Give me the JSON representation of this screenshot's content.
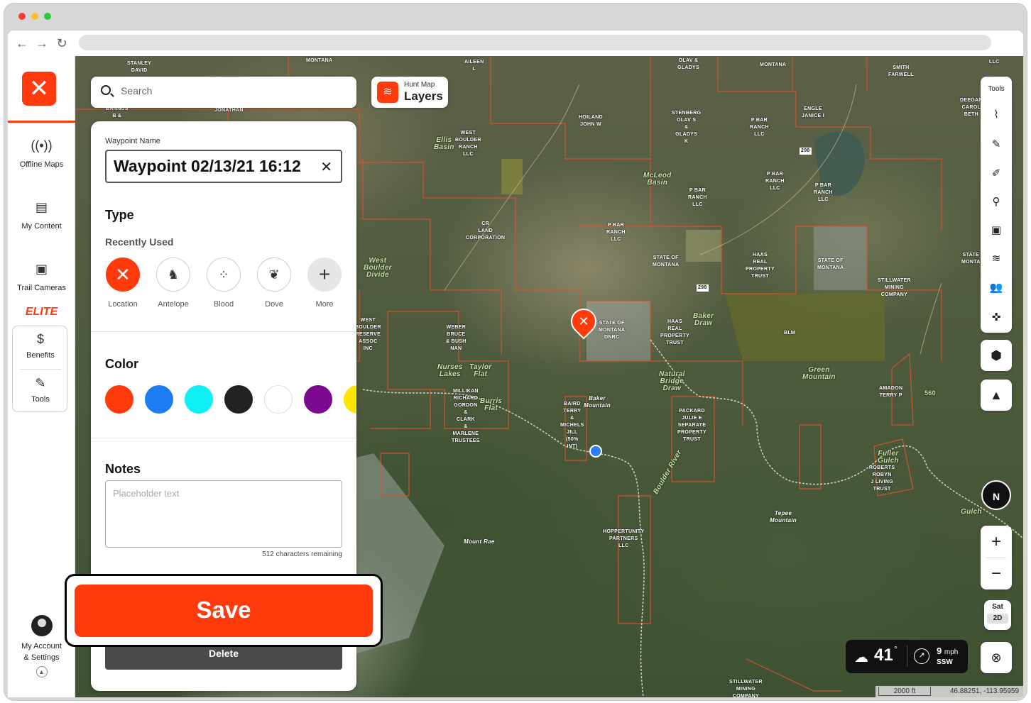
{
  "browser": {
    "traffic_colors": [
      "#ff3b30",
      "#ffbd2e",
      "#28c940"
    ],
    "nav_icons": [
      "back-arrow-icon",
      "forward-arrow-icon",
      "reload-icon"
    ]
  },
  "leftnav": {
    "logo_icon": "onx-x-icon",
    "items": [
      {
        "label": "Offline Maps",
        "icon": "broadcast-icon"
      },
      {
        "label": "My Content",
        "icon": "folder-icon"
      },
      {
        "label": "Trail Cameras",
        "icon": "camera-icon"
      }
    ],
    "elite": "ELITE",
    "benefits_label": "Benefits",
    "tools_label": "Tools",
    "account_line1": "My Account",
    "account_line2": "& Settings"
  },
  "search": {
    "placeholder": "Search"
  },
  "layers": {
    "small": "Hunt Map",
    "big": "Layers"
  },
  "panel": {
    "waypoint_label": "Waypoint Name",
    "waypoint_value": "Waypoint 02/13/21 16:12",
    "type_heading": "Type",
    "recently_used": "Recently Used",
    "types": [
      {
        "label": "Location",
        "glyph": "✕",
        "icon": "location-x-icon"
      },
      {
        "label": "Antelope",
        "glyph": "♞",
        "icon": "antelope-icon"
      },
      {
        "label": "Blood",
        "glyph": "⁘",
        "icon": "blood-drops-icon"
      },
      {
        "label": "Dove",
        "glyph": "❦",
        "icon": "dove-icon"
      },
      {
        "label": "More",
        "glyph": "+",
        "icon": "plus-icon"
      }
    ],
    "color_heading": "Color",
    "colors": [
      "#ff3a0d",
      "#1e7cf2",
      "#0ff0f5",
      "#222222",
      "#ffffff",
      "#7b0a8f",
      "#ffe600"
    ],
    "notes_heading": "Notes",
    "notes_placeholder": "Placeholder text",
    "chars_remaining": "512 characters remaining",
    "save": "Save",
    "delete": "Delete"
  },
  "tools": {
    "label": "Tools",
    "icons": [
      "lasso-icon",
      "pencil-icon",
      "eraser-icon",
      "map-pin-icon",
      "trail-camera-icon",
      "wind-icon",
      "people-icon",
      "satellite-icon"
    ]
  },
  "map_controls": {
    "hunt-icon": "hunt-area-icon",
    "terrain-icon": "terrain-icon",
    "compass": "N",
    "sat": "Sat",
    "mode": "2D"
  },
  "weather": {
    "temp": "41",
    "deg": "°",
    "wind_speed": "9",
    "wind_unit": "mph",
    "wind_dir": "SSW"
  },
  "status": {
    "scale": "2000 ft",
    "coords": "46.88251, -113.95959"
  },
  "map_labels": [
    "STANLEY\nDAVID",
    "MONTANA",
    "AILEEN\nL",
    "OLAV &\nGLADYS",
    "MONTANA",
    "SMITH\nFARWELL",
    "LLC",
    "DEEGAN\nCAROL\nBETH",
    "BANNUS\nB &",
    "JONATHAN",
    "HOILAND\nJOHN W",
    "STENBERG\nOLAV S\n&\nGLADYS\nK",
    "P BAR\nRANCH\nLLC",
    "ENGLE\nJANICE I",
    "WEST\nBOULDER\nRANCH\nLLC",
    "P BAR\nRANCH\nLLC",
    "P BAR\nRANCH\nLLC",
    "P BAR\nRANCH\nLLC",
    "CR\nLAND\nCORPORATION",
    "P BAR\nRANCH\nLLC",
    "STATE OF\nMONTANA",
    "HAAS\nREAL\nPROPERTY\nTRUST",
    "STATE OF\nMONTANA",
    "STATE\nMONTA",
    "STILLWATER\nMINING\nCOMPANY",
    "WEST\nBOULDER\nRESERVE\nASSOC\nINC",
    "WEBER\nBRUCE\n& BUSH\nNAN",
    "STATE OF\nMONTANA\nDNRC",
    "HAAS\nREAL\nPROPERTY\nTRUST",
    "BLM",
    "AMADON\nTERRY P",
    "MILLIKAN\nRICHARD\nGORDON\n&\nCLARK\n&\nMARLENE\nTRUSTEES",
    "BAIRD\nTERRY\n&\nMICHELS\nJILL\n(50%\nINT)",
    "PACKARD\nJULIE E\nSEPARATE\nPROPERTY\nTRUST",
    "ROBERTS\nROBYN\nJ LIVING\nTRUST",
    "HOPPERTUNITY\nPARTNERS\nLLC",
    "STILLWATER\nMINING\nCOMPANY",
    "298",
    "298",
    "560"
  ],
  "geo_labels": [
    "Ellis\nBasin",
    "McLeod\nBasin",
    "West\nBoulder\nDivide",
    "Baker\nDraw",
    "Green\nMountain",
    "Taylor\nFlat",
    "Nurses\nLakes",
    "Burris\nFlat",
    "Natural\nBridge\nDraw",
    "Baker\nMountain",
    "Mount Rae",
    "Tepee\nMountain",
    "Boulder River",
    "Fuller\nGulch",
    "Gulch"
  ]
}
